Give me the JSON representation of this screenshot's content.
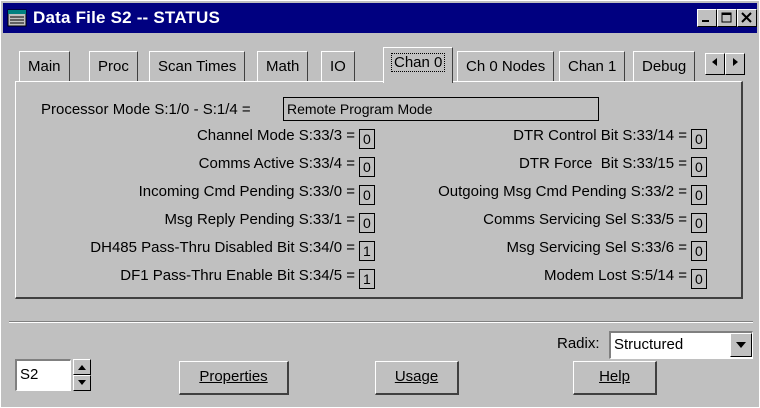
{
  "window": {
    "title": "Data File S2  --  STATUS",
    "minimize_glyph": "_",
    "maximize_glyph": "□",
    "close_glyph": "×"
  },
  "tabs": [
    {
      "label": "Main"
    },
    {
      "label": "Proc"
    },
    {
      "label": "Scan Times"
    },
    {
      "label": "Math"
    },
    {
      "label": "IO"
    },
    {
      "label": "Chan 0"
    },
    {
      "label": "Ch 0 Nodes"
    },
    {
      "label": "Chan 1"
    },
    {
      "label": "Debug"
    }
  ],
  "active_tab": "Chan 0",
  "processor_mode": {
    "label": "Processor Mode S:1/0 - S:1/4 =",
    "value": "Remote Program Mode"
  },
  "left_fields": [
    {
      "label": "Channel Mode S:33/3 =",
      "value": "0"
    },
    {
      "label": "Comms Active S:33/4 =",
      "value": "0"
    },
    {
      "label": "Incoming Cmd Pending S:33/0 =",
      "value": "0"
    },
    {
      "label": "Msg Reply Pending S:33/1 =",
      "value": "0"
    },
    {
      "label": "DH485 Pass-Thru Disabled Bit S:34/0 =",
      "value": "1"
    },
    {
      "label": "DF1 Pass-Thru Enable Bit S:34/5 =",
      "value": "1"
    }
  ],
  "right_fields": [
    {
      "label": "DTR Control Bit S:33/14 =",
      "value": "0"
    },
    {
      "label": "DTR Force  Bit S:33/15 =",
      "value": "0"
    },
    {
      "label": "Outgoing Msg Cmd Pending S:33/2 =",
      "value": "0"
    },
    {
      "label": "Comms Servicing Sel S:33/5 =",
      "value": "0"
    },
    {
      "label": "Msg Servicing Sel S:33/6 =",
      "value": "0"
    },
    {
      "label": "Modem Lost S:5/14 =",
      "value": "0"
    }
  ],
  "radix": {
    "label": "Radix:",
    "value": "Structured"
  },
  "file_field": {
    "value": "S2"
  },
  "buttons": {
    "properties": "Properties",
    "usage": "Usage",
    "help": "Help"
  }
}
